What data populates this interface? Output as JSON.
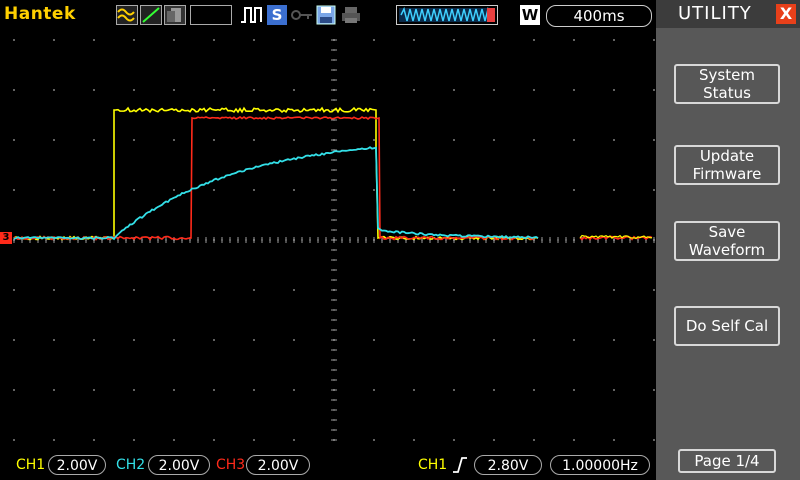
{
  "header": {
    "brand": "Hantek",
    "timebase": "400ms",
    "mode_letter": "W",
    "s_letter": "S",
    "icons": [
      "waveform-mode-icon",
      "slope-icon",
      "persist-icon",
      "pulse-trigger-icon",
      "s-icon",
      "key-icon",
      "save-icon",
      "print-icon",
      "memory-bar-icon",
      "w-icon"
    ]
  },
  "panel": {
    "title": "UTILITY",
    "close": "X",
    "buttons": [
      {
        "line1": "System",
        "line2": "Status"
      },
      {
        "line1": "Update",
        "line2": "Firmware"
      },
      {
        "line1": "Save",
        "line2": "Waveform"
      },
      {
        "line1": "Do Self Cal",
        "line2": ""
      }
    ],
    "page": "Page 1/4"
  },
  "footer": {
    "ch1_label": "CH1",
    "ch1_value": "2.00V",
    "ch2_label": "CH2",
    "ch2_value": "2.00V",
    "ch3_label": "CH3",
    "ch3_value": "2.00V",
    "trig_label": "CH1",
    "trig_level": "2.80V",
    "frequency": "1.00000Hz"
  },
  "marker": "3",
  "colors": {
    "ch1": "#ffff00",
    "ch2": "#33e0e8",
    "ch3": "#ff2a1a",
    "grid": "#9a9a9a",
    "brand": "#ffd000"
  }
}
